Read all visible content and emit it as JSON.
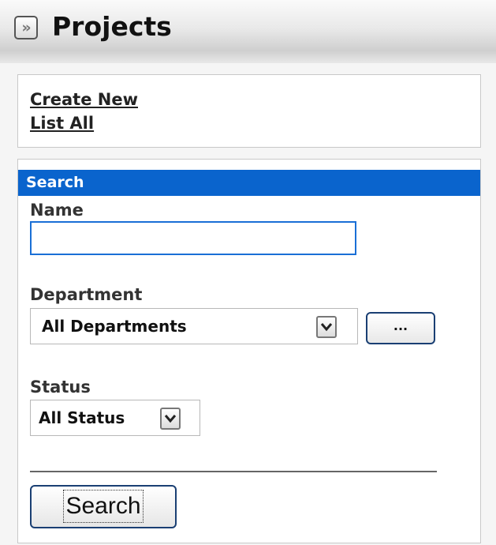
{
  "header": {
    "title": "Projects",
    "collapse_glyph": "»",
    "collapse_icon": "double-chevron-right-icon"
  },
  "links": {
    "create_new": "Create New",
    "list_all": "List All"
  },
  "search": {
    "header": "Search",
    "name_label": "Name",
    "name_value": "",
    "department_label": "Department",
    "department_value": "All Departments",
    "browse_label": "...",
    "status_label": "Status",
    "status_value": "All Status",
    "submit_label": "Search"
  },
  "colors": {
    "accent": "#0a64cd",
    "button_border": "#1a3f73"
  }
}
